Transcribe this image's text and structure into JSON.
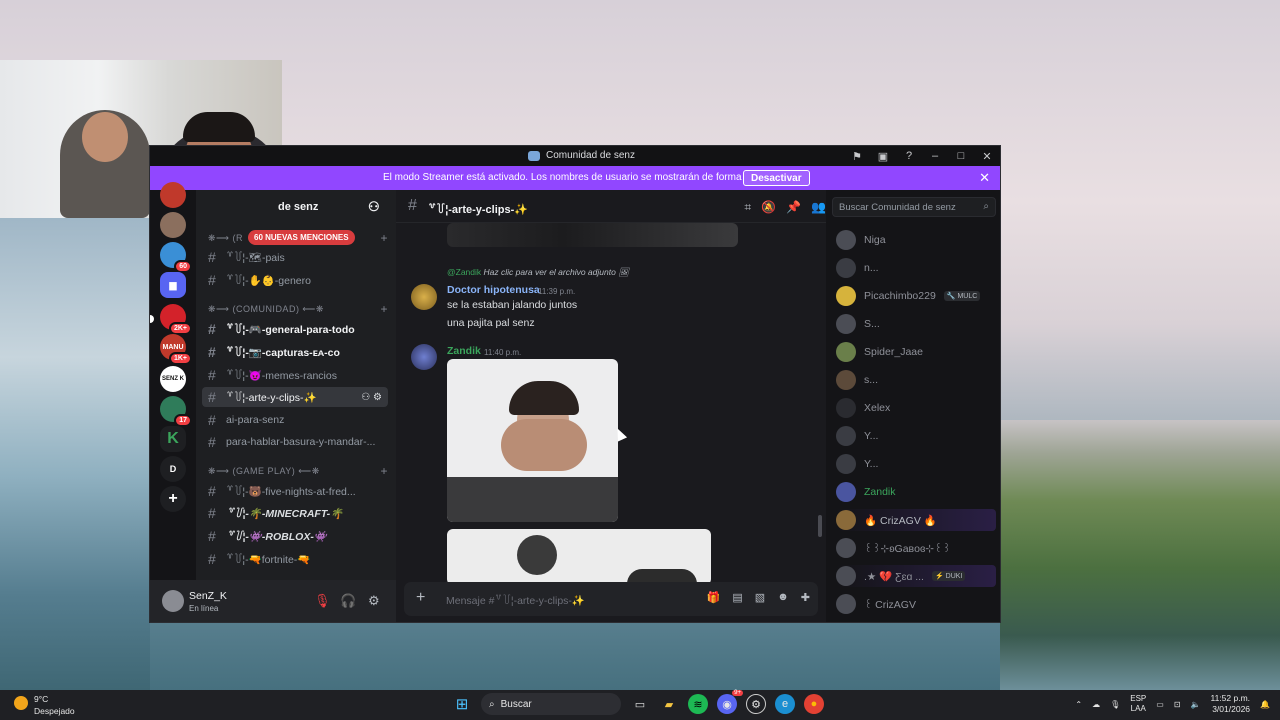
{
  "window": {
    "title": "Comunidad de senz"
  },
  "banner": {
    "text": "El modo Streamer está activado. Los nombres de usuario se mostrarán de forma parcial.",
    "button": "Desactivar"
  },
  "server": {
    "name": "de senz",
    "mentions": "60 NUEVAS MENCIONES"
  },
  "servers": [
    {
      "badge": ""
    },
    {
      "badge": "60"
    },
    {
      "badge": ""
    },
    {
      "badge": "2K+"
    },
    {
      "label": "MANU",
      "badge": "1K+"
    },
    {
      "label": "SENZ K",
      "badge": ""
    },
    {
      "badge": "17"
    },
    {
      "badge": ""
    },
    {
      "label": "D",
      "badge": ""
    }
  ],
  "categories": {
    "top": "❋⟶ (R",
    "comunidad": "❋⟶ (COMUNIDAD) ⟵❋",
    "gameplay": "❋⟶ (GAME PLAY) ⟵❋"
  },
  "channels": [
    {
      "name": "꒷꒦¦-🗺-pais"
    },
    {
      "name": "꒷꒦¦-✋👶-genero"
    },
    {
      "name": "꒷꒦¦-🎮-general-para-todo"
    },
    {
      "name": "꒷꒦¦-📷-capturas-ᴇᴀ-ᴄᴏ"
    },
    {
      "name": "꒷꒦¦-😈-memes-rancios"
    },
    {
      "name": "꒷꒦¦-arte-y-clips-✨"
    },
    {
      "name": "ai-para-senz"
    },
    {
      "name": "para-hablar-basura-y-mandar-..."
    },
    {
      "name": "꒷꒦¦-🐻-five-nights-at-fred..."
    },
    {
      "name": "꒷꒦¦-🌴-MINECRAFT-🌴"
    },
    {
      "name": "꒷꒦¦-👾-ROBLOX-👾"
    },
    {
      "name": "꒷꒦¦-🔫fortnite-🔫"
    }
  ],
  "user": {
    "name": "SenZ_K",
    "status": "En línea"
  },
  "chat": {
    "channel": "꒷꒦¦-arte-y-clips-✨",
    "reply_user": "@Zandik",
    "reply_text": "Haz clic para ver el archivo adjunto",
    "msg1_author": "Doctor hipotenusa",
    "msg1_time": "11:39 p.m.",
    "msg1_line1": "se la estaban jalando juntos",
    "msg1_line2": "una pajita pal senz",
    "msg2_author": "Zandik",
    "msg2_time": "11:40 p.m.",
    "input_placeholder": "Mensaje #꒷꒦¦-arte-y-clips-✨"
  },
  "members": {
    "search_placeholder": "Buscar Comunidad de senz",
    "list": [
      {
        "name": "Niga",
        "tag": ""
      },
      {
        "name": "n...",
        "tag": ""
      },
      {
        "name": "Picachimbo229",
        "tag": "🔧 MULC"
      },
      {
        "name": "S...",
        "tag": ""
      },
      {
        "name": "Spider_Jaae",
        "tag": ""
      },
      {
        "name": "s...",
        "tag": ""
      },
      {
        "name": "Xelex",
        "tag": ""
      },
      {
        "name": "Y...",
        "tag": ""
      },
      {
        "name": "Y...",
        "tag": ""
      },
      {
        "name": "Zandik",
        "tag": ""
      },
      {
        "name": "🔥 CrizAGV 🔥",
        "tag": ""
      },
      {
        "name": "꒰꒱⊹ʚGaʙoɞ⊹꒰꒱",
        "tag": ""
      },
      {
        "name": ".★ 💔 Ƹɛɑ ...",
        "tag": "⚡ DUKI"
      },
      {
        "name": "꒰ CrizAGV",
        "tag": ""
      }
    ]
  },
  "taskbar": {
    "temp": "9°C",
    "weather": "Despejado",
    "search": "Buscar",
    "lang1": "ESP",
    "lang2": "LAA",
    "time": "11:52 p.m.",
    "date": "3/01/2026",
    "discord_badge": "9+"
  },
  "colors": {
    "accent": "#9147ff",
    "mention": "#d83c3e",
    "zandik": "#3ba55c",
    "doctor": "#8ab4f8"
  }
}
